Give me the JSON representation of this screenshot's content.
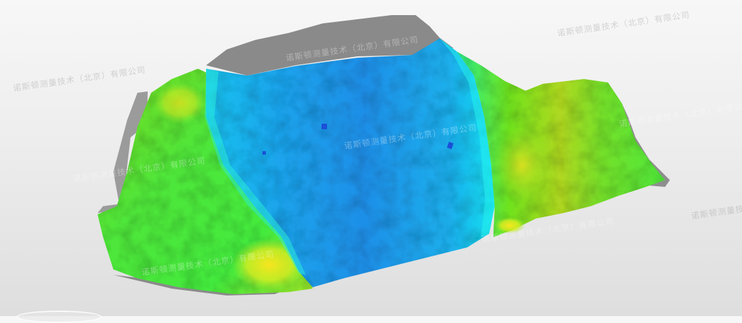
{
  "viewer": {
    "watermark_text": "诺斯顿测量技术（北京）有限公司"
  },
  "colors": {
    "background_top": "#f7f7f7",
    "background_bottom": "#dedede",
    "mesh_grey": "#8a8a8a",
    "deviation_low": "#1e88e5",
    "deviation_mid_low": "#00e5ff",
    "deviation_mid": "#39e639",
    "deviation_mid_high": "#b4f01e",
    "deviation_high": "#f5e61e"
  },
  "icons": {
    "model": "3d-scan-deviation-map"
  }
}
